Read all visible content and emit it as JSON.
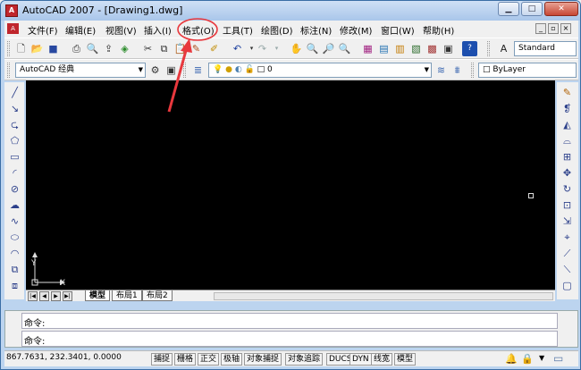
{
  "window": {
    "title": "AutoCAD 2007 - [Drawing1.dwg]"
  },
  "menu": {
    "items": [
      "文件(F)",
      "编辑(E)",
      "视图(V)",
      "插入(I)",
      "格式(O)",
      "工具(T)",
      "绘图(D)",
      "标注(N)",
      "修改(M)",
      "窗口(W)",
      "帮助(H)"
    ]
  },
  "toolbar": {
    "text_style": "Standard"
  },
  "workspace": {
    "value": "AutoCAD 经典"
  },
  "layer": {
    "current": "0"
  },
  "properties": {
    "color": "ByLayer"
  },
  "ucs": {
    "x_label": "X",
    "y_label": "Y"
  },
  "layout_tabs": [
    "模型",
    "布局1",
    "布局2"
  ],
  "command": {
    "line1": "命令:",
    "line2": "命令:"
  },
  "status": {
    "coords": "867.7631, 232.3401, 0.0000",
    "buttons": [
      "捕捉",
      "栅格",
      "正交",
      "极轴",
      "对象捕捉",
      "对象追踪",
      "DUCS",
      "DYN",
      "线宽",
      "模型"
    ]
  },
  "colors": {
    "highlight": "#e8383d",
    "canvas": "#000000"
  }
}
